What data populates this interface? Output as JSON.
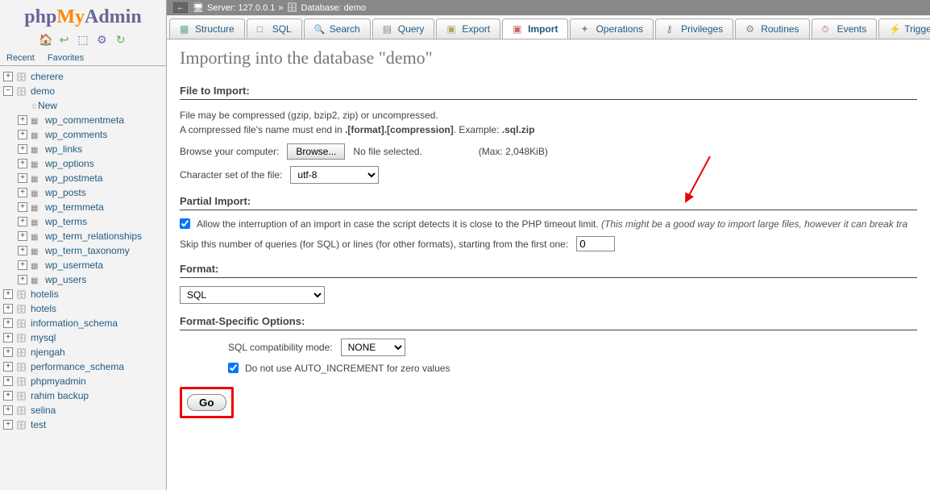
{
  "breadcrumb": {
    "server": "Server: 127.0.0.1",
    "database": "Database: demo"
  },
  "tabs": {
    "structure": "Structure",
    "sql": "SQL",
    "search": "Search",
    "query": "Query",
    "export": "Export",
    "import": "Import",
    "operations": "Operations",
    "privileges": "Privileges",
    "routines": "Routines",
    "events": "Events",
    "triggers": "Triggers"
  },
  "page": {
    "title": "Importing into the database \"demo\""
  },
  "fileImport": {
    "heading": "File to Import:",
    "desc1": "File may be compressed (gzip, bzip2, zip) or uncompressed.",
    "desc2a": "A compressed file's name must end in ",
    "desc2b": ".[format].[compression]",
    "desc2c": ". Example: ",
    "desc2d": ".sql.zip",
    "browseLabel": "Browse your computer:",
    "browseBtn": "Browse...",
    "noFile": "No file selected.",
    "max": "(Max: 2,048KiB)",
    "charsetLabel": "Character set of the file:",
    "charsetValue": "utf-8"
  },
  "partial": {
    "heading": "Partial Import:",
    "allow1": "Allow the interruption of an import in case the script detects it is close to the PHP timeout limit. ",
    "allow2": "(This might be a good way to import large files, however it can break tra",
    "skipLabel": "Skip this number of queries (for SQL) or lines (for other formats), starting from the first one:",
    "skipValue": "0"
  },
  "format": {
    "heading": "Format:",
    "value": "SQL"
  },
  "specific": {
    "heading": "Format-Specific Options:",
    "compatLabel": "SQL compatibility mode:",
    "compatValue": "NONE",
    "noAuto1": "Do not use ",
    "noAuto2": "AUTO_INCREMENT",
    "noAuto3": " for zero values"
  },
  "go": "Go",
  "sidebar": {
    "recent": "Recent",
    "favorites": "Favorites",
    "new": "New",
    "dbs_top": [
      "cherere"
    ],
    "expanded_db": "demo",
    "tables": [
      "wp_commentmeta",
      "wp_comments",
      "wp_links",
      "wp_options",
      "wp_postmeta",
      "wp_posts",
      "wp_termmeta",
      "wp_terms",
      "wp_term_relationships",
      "wp_term_taxonomy",
      "wp_usermeta",
      "wp_users"
    ],
    "dbs_bottom": [
      "hotelis",
      "hotels",
      "information_schema",
      "mysql",
      "njengah",
      "performance_schema",
      "phpmyadmin",
      "rahim backup",
      "selina",
      "test"
    ]
  }
}
